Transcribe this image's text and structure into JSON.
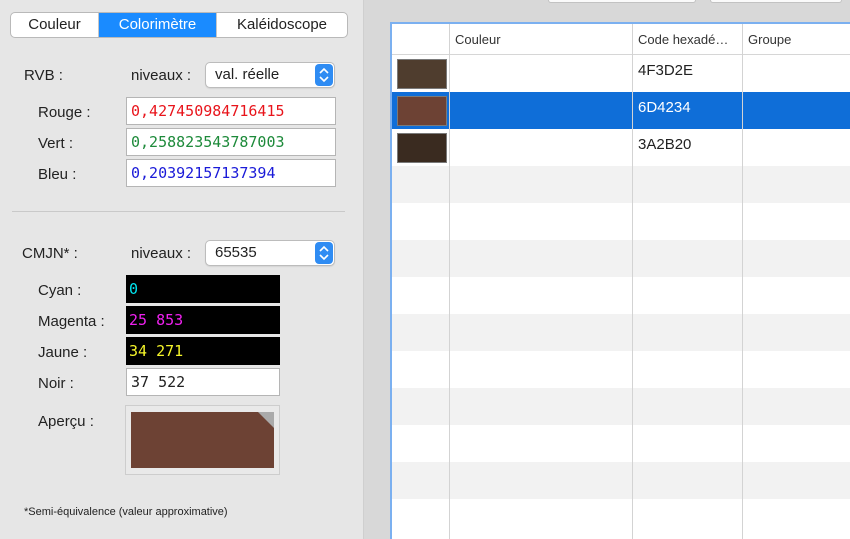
{
  "tabs": [
    {
      "label": "Couleur",
      "active": false
    },
    {
      "label": "Colorimètre",
      "active": true
    },
    {
      "label": "Kaléidoscope",
      "active": false
    }
  ],
  "rgb": {
    "section_label": "RVB :",
    "levels_label": "niveaux :",
    "levels_value": "val. réelle",
    "red_label": "Rouge :",
    "red_value": "0,427450984716415",
    "green_label": "Vert :",
    "green_value": "0,258823543787003",
    "blue_label": "Bleu :",
    "blue_value": "0,20392157137394"
  },
  "cmyk": {
    "section_label": "CMJN* :",
    "levels_label": "niveaux :",
    "levels_value": "65535",
    "cyan_label": "Cyan :",
    "cyan_value": "0",
    "magenta_label": "Magenta :",
    "magenta_value": "25 853",
    "yellow_label": "Jaune :",
    "yellow_value": "34 271",
    "black_label": "Noir :",
    "black_value": "37 522"
  },
  "preview": {
    "label": "Aperçu :",
    "color": "#6D4234"
  },
  "footnote": "*Semi-équivalence (valeur approximative)",
  "colors": {
    "red_text": "#e8141b",
    "green_text": "#1d8a3a",
    "blue_text": "#1a1ad8",
    "cyan_text": "#00e5f0",
    "magenta_text": "#f021f0",
    "yellow_text": "#f5f52a",
    "accent": "#1a8bff",
    "selection": "#0f6ed8"
  },
  "table": {
    "columns": [
      "",
      "Couleur",
      "Code hexadé…",
      "Groupe"
    ],
    "rows": [
      {
        "swatch": "#4F3D2E",
        "hex": "4F3D2E",
        "selected": false
      },
      {
        "swatch": "#6D4234",
        "hex": "6D4234",
        "selected": true
      },
      {
        "swatch": "#3A2B20",
        "hex": "3A2B20",
        "selected": false
      }
    ]
  }
}
